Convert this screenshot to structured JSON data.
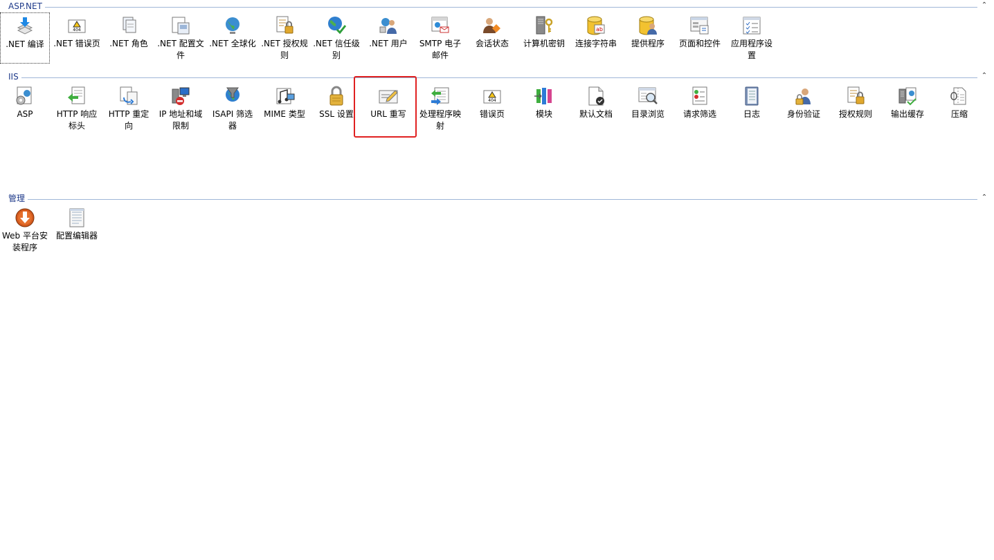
{
  "sections": [
    {
      "title": "ASP.NET",
      "items": [
        {
          "label": ".NET 编译",
          "icon": "dotnet-compile-icon"
        },
        {
          "label": ".NET 错误页",
          "icon": "error-404-icon"
        },
        {
          "label": ".NET 角色",
          "icon": "roles-icon"
        },
        {
          "label": ".NET 配置文件",
          "icon": "profile-icon"
        },
        {
          "label": ".NET 全球化",
          "icon": "globe-icon"
        },
        {
          "label": ".NET 授权规则",
          "icon": "auth-rules-icon"
        },
        {
          "label": ".NET 信任级别",
          "icon": "trust-level-icon"
        },
        {
          "label": ".NET 用户",
          "icon": "users-icon"
        },
        {
          "label": "SMTP 电子邮件",
          "icon": "email-icon"
        },
        {
          "label": "会话状态",
          "icon": "session-icon"
        },
        {
          "label": "计算机密钥",
          "icon": "machine-key-icon"
        },
        {
          "label": "连接字符串",
          "icon": "connection-string-icon"
        },
        {
          "label": "提供程序",
          "icon": "providers-icon"
        },
        {
          "label": "页面和控件",
          "icon": "pages-controls-icon"
        },
        {
          "label": "应用程序设置",
          "icon": "app-settings-icon"
        }
      ]
    },
    {
      "title": "IIS",
      "items": [
        {
          "label": "ASP",
          "icon": "asp-icon"
        },
        {
          "label": "HTTP 响应标头",
          "icon": "http-headers-icon"
        },
        {
          "label": "HTTP 重定向",
          "icon": "redirect-icon"
        },
        {
          "label": "IP 地址和域限制",
          "icon": "ip-restrict-icon"
        },
        {
          "label": "ISAPI 筛选器",
          "icon": "isapi-icon"
        },
        {
          "label": "MIME 类型",
          "icon": "mime-icon"
        },
        {
          "label": "SSL 设置",
          "icon": "ssl-lock-icon"
        },
        {
          "label": "URL 重写",
          "icon": "url-rewrite-icon"
        },
        {
          "label": "处理程序映射",
          "icon": "handler-mapping-icon"
        },
        {
          "label": "错误页",
          "icon": "error-404-icon"
        },
        {
          "label": "模块",
          "icon": "modules-icon"
        },
        {
          "label": "默认文档",
          "icon": "default-doc-icon"
        },
        {
          "label": "目录浏览",
          "icon": "dir-browse-icon"
        },
        {
          "label": "请求筛选",
          "icon": "request-filter-icon"
        },
        {
          "label": "日志",
          "icon": "logging-icon"
        },
        {
          "label": "身份验证",
          "icon": "authentication-icon"
        },
        {
          "label": "授权规则",
          "icon": "auth-rules-icon"
        },
        {
          "label": "输出缓存",
          "icon": "output-cache-icon"
        },
        {
          "label": "压缩",
          "icon": "compression-icon"
        }
      ]
    },
    {
      "title": "管理",
      "items": [
        {
          "label": "Web 平台安装程序",
          "icon": "web-platform-icon"
        },
        {
          "label": "配置编辑器",
          "icon": "config-editor-icon"
        }
      ]
    }
  ],
  "toggle_glyph": "⌃",
  "highlight_color": "#e02020"
}
